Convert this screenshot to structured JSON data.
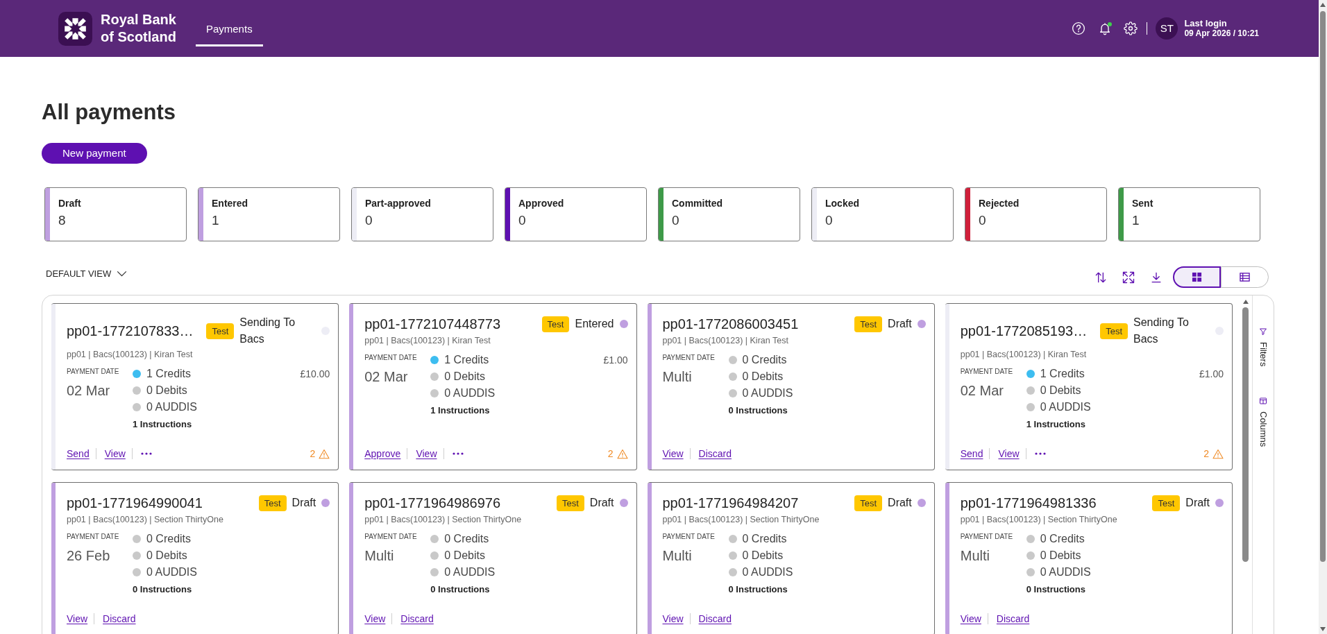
{
  "header": {
    "brand": "Royal Bank\nof Scotland",
    "nav": [
      {
        "label": "Payments",
        "selected": true
      }
    ],
    "notifications_unread": true,
    "avatar": "ST",
    "last_login_label": "Last login",
    "last_login": "09 Apr 2026 / 10:21"
  },
  "page": {
    "title": "All payments",
    "new_button": "New payment"
  },
  "status_summary": [
    {
      "label": "Draft",
      "count": "8",
      "color": "#bf9fe0"
    },
    {
      "label": "Entered",
      "count": "1",
      "color": "#bf9fe0"
    },
    {
      "label": "Part-approved",
      "count": "0",
      "color": "#ededf5"
    },
    {
      "label": "Approved",
      "count": "0",
      "color": "#5e10b1"
    },
    {
      "label": "Committed",
      "count": "0",
      "color": "#3e9a48"
    },
    {
      "label": "Locked",
      "count": "0",
      "color": "#ededf5"
    },
    {
      "label": "Rejected",
      "count": "0",
      "color": "#d0203b"
    },
    {
      "label": "Sent",
      "count": "1",
      "color": "#3e9a48"
    }
  ],
  "view": {
    "label": "DEFAULT VIEW",
    "layouts": [
      {
        "kind": "grid",
        "selected": true
      },
      {
        "kind": "list",
        "selected": false
      }
    ]
  },
  "payments": [
    {
      "id": "pp01-1772107833…",
      "badge": "Test",
      "status": "Sending To Bacs",
      "color": "#ededf5",
      "details": "pp01 | Bacs(100123) | Kiran Test",
      "date_label": "PAYMENT DATE",
      "date": "02 Mar",
      "counts": [
        {
          "label": "1 Credits",
          "color": "#3dbdf0"
        },
        {
          "label": "0 Debits",
          "color": "#c9c9c9"
        },
        {
          "label": "0 AUDDIS",
          "color": "#c9c9c9"
        }
      ],
      "instructions": "1 Instructions",
      "amount": "£10.00",
      "actions": [
        {
          "kind": "link",
          "label": "Send"
        },
        {
          "kind": "link",
          "label": "View"
        },
        {
          "kind": "more"
        }
      ],
      "warnings": "2"
    },
    {
      "id": "pp01-1772107448773",
      "badge": "Test",
      "status": "Entered",
      "color": "#bf9fe0",
      "details": "pp01 | Bacs(100123) | Kiran Test",
      "date_label": "PAYMENT DATE",
      "date": "02 Mar",
      "counts": [
        {
          "label": "1 Credits",
          "color": "#3dbdf0"
        },
        {
          "label": "0 Debits",
          "color": "#c9c9c9"
        },
        {
          "label": "0 AUDDIS",
          "color": "#c9c9c9"
        }
      ],
      "instructions": "1 Instructions",
      "amount": "£1.00",
      "actions": [
        {
          "kind": "link",
          "label": "Approve"
        },
        {
          "kind": "link",
          "label": "View"
        },
        {
          "kind": "more"
        }
      ],
      "warnings": "2"
    },
    {
      "id": "pp01-1772086003451",
      "badge": "Test",
      "status": "Draft",
      "color": "#bf9fe0",
      "details": "pp01 | Bacs(100123) | Kiran Test",
      "date_label": "PAYMENT DATE",
      "date": "Multi",
      "counts": [
        {
          "label": "0 Credits",
          "color": "#c9c9c9"
        },
        {
          "label": "0 Debits",
          "color": "#c9c9c9"
        },
        {
          "label": "0 AUDDIS",
          "color": "#c9c9c9"
        }
      ],
      "instructions": "0 Instructions",
      "actions": [
        {
          "kind": "link",
          "label": "View"
        },
        {
          "kind": "link",
          "label": "Discard"
        }
      ]
    },
    {
      "id": "pp01-1772085193…",
      "badge": "Test",
      "status": "Sending To Bacs",
      "color": "#ededf5",
      "details": "pp01 | Bacs(100123) | Kiran Test",
      "date_label": "PAYMENT DATE",
      "date": "02 Mar",
      "counts": [
        {
          "label": "1 Credits",
          "color": "#3dbdf0"
        },
        {
          "label": "0 Debits",
          "color": "#c9c9c9"
        },
        {
          "label": "0 AUDDIS",
          "color": "#c9c9c9"
        }
      ],
      "instructions": "1 Instructions",
      "amount": "£1.00",
      "actions": [
        {
          "kind": "link",
          "label": "Send"
        },
        {
          "kind": "link",
          "label": "View"
        },
        {
          "kind": "more"
        }
      ],
      "warnings": "2"
    },
    {
      "id": "pp01-1771964990041",
      "badge": "Test",
      "status": "Draft",
      "color": "#bf9fe0",
      "details": "pp01 | Bacs(100123) | Section ThirtyOne",
      "date_label": "PAYMENT DATE",
      "date": "26 Feb",
      "counts": [
        {
          "label": "0 Credits",
          "color": "#c9c9c9"
        },
        {
          "label": "0 Debits",
          "color": "#c9c9c9"
        },
        {
          "label": "0 AUDDIS",
          "color": "#c9c9c9"
        }
      ],
      "instructions": "0 Instructions",
      "actions": [
        {
          "kind": "link",
          "label": "View"
        },
        {
          "kind": "link",
          "label": "Discard"
        }
      ]
    },
    {
      "id": "pp01-1771964986976",
      "badge": "Test",
      "status": "Draft",
      "color": "#bf9fe0",
      "details": "pp01 | Bacs(100123) | Section ThirtyOne",
      "date_label": "PAYMENT DATE",
      "date": "Multi",
      "counts": [
        {
          "label": "0 Credits",
          "color": "#c9c9c9"
        },
        {
          "label": "0 Debits",
          "color": "#c9c9c9"
        },
        {
          "label": "0 AUDDIS",
          "color": "#c9c9c9"
        }
      ],
      "instructions": "0 Instructions",
      "actions": [
        {
          "kind": "link",
          "label": "View"
        },
        {
          "kind": "link",
          "label": "Discard"
        }
      ]
    },
    {
      "id": "pp01-1771964984207",
      "badge": "Test",
      "status": "Draft",
      "color": "#bf9fe0",
      "details": "pp01 | Bacs(100123) | Section ThirtyOne",
      "date_label": "PAYMENT DATE",
      "date": "Multi",
      "counts": [
        {
          "label": "0 Credits",
          "color": "#c9c9c9"
        },
        {
          "label": "0 Debits",
          "color": "#c9c9c9"
        },
        {
          "label": "0 AUDDIS",
          "color": "#c9c9c9"
        }
      ],
      "instructions": "0 Instructions",
      "actions": [
        {
          "kind": "link",
          "label": "View"
        },
        {
          "kind": "link",
          "label": "Discard"
        }
      ]
    },
    {
      "id": "pp01-1771964981336",
      "badge": "Test",
      "status": "Draft",
      "color": "#bf9fe0",
      "details": "pp01 | Bacs(100123) | Section ThirtyOne",
      "date_label": "PAYMENT DATE",
      "date": "Multi",
      "counts": [
        {
          "label": "0 Credits",
          "color": "#c9c9c9"
        },
        {
          "label": "0 Debits",
          "color": "#c9c9c9"
        },
        {
          "label": "0 AUDDIS",
          "color": "#c9c9c9"
        }
      ],
      "instructions": "0 Instructions",
      "actions": [
        {
          "kind": "link",
          "label": "View"
        },
        {
          "kind": "link",
          "label": "Discard"
        }
      ]
    }
  ],
  "side_panel": [
    {
      "kind": "filters",
      "label": "Filters"
    },
    {
      "kind": "columns",
      "label": "Columns"
    }
  ]
}
